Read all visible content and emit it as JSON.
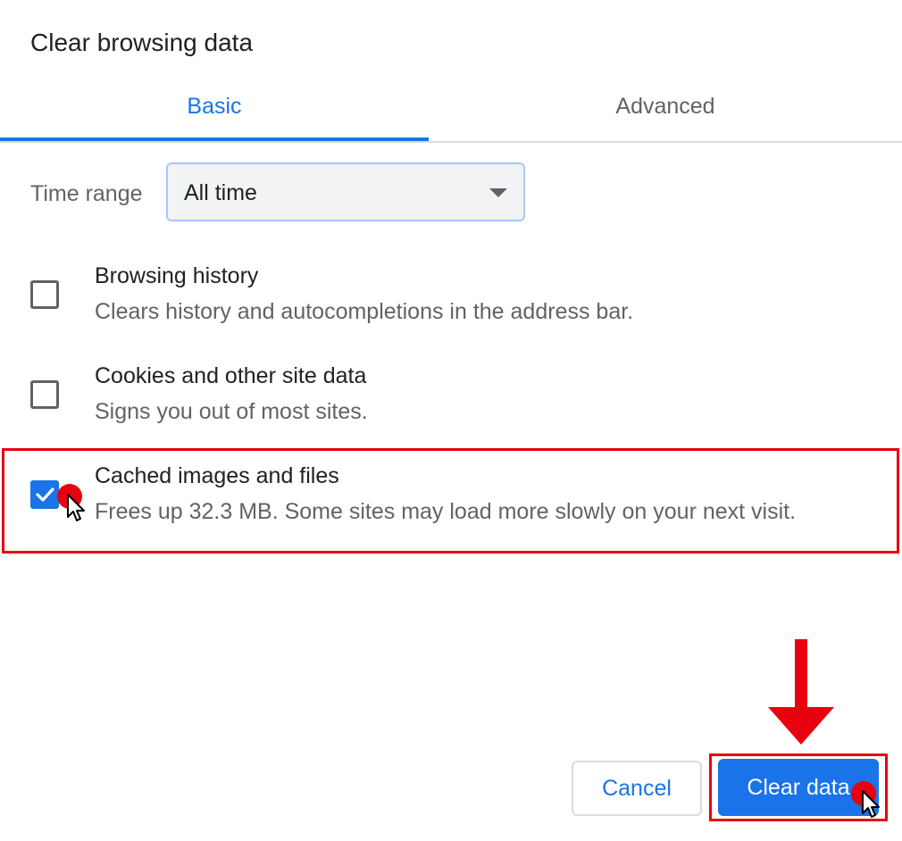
{
  "dialog": {
    "title": "Clear browsing data"
  },
  "tabs": [
    {
      "label": "Basic",
      "active": true
    },
    {
      "label": "Advanced",
      "active": false
    }
  ],
  "time_range": {
    "label": "Time range",
    "selected": "All time"
  },
  "options": [
    {
      "title": "Browsing history",
      "description": "Clears history and autocompletions in the address bar.",
      "checked": false
    },
    {
      "title": "Cookies and other site data",
      "description": "Signs you out of most sites.",
      "checked": false
    },
    {
      "title": "Cached images and files",
      "description": "Frees up 32.3 MB. Some sites may load more slowly on your next visit.",
      "checked": true
    }
  ],
  "buttons": {
    "cancel_label": "Cancel",
    "clear_label": "Clear data"
  },
  "colors": {
    "accent": "#1a73e8",
    "annotation_red": "#e8000f",
    "secondary_text": "#5f6368"
  },
  "icons": {
    "checkmark": "check-icon",
    "dropdown": "triangle-down-icon",
    "cursor": "mouse-pointer-icon"
  }
}
